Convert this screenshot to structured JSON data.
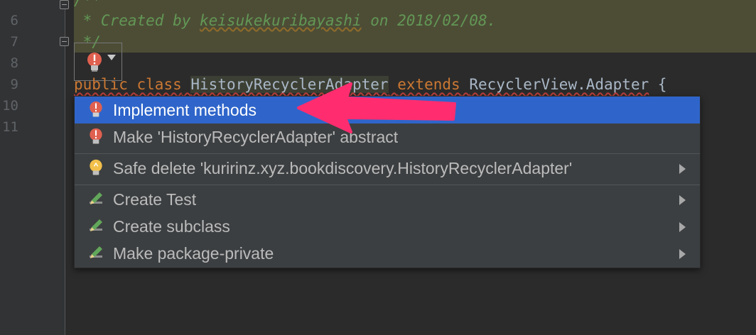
{
  "editor": {
    "line_numbers": [
      "6",
      "7",
      "8",
      "9",
      "10",
      "11"
    ],
    "comment_line_6_prefix": " * Created by ",
    "comment_line_6_author": "keisukekuribayashi",
    "comment_line_6_suffix": " on 2018/02/08.",
    "comment_line_7": " */",
    "comment_line_5_partial": "/**",
    "code_line_9": {
      "kw_public": "public",
      "kw_class": "class",
      "class_name": "HistoryRecyclerAdapter",
      "kw_extends": "extends",
      "super_class": "RecyclerView.Adapter",
      "brace": "{"
    }
  },
  "intention_bulb": {
    "icon": "red-bulb-icon",
    "dropdown_icon": "chevron-down-icon"
  },
  "popup": {
    "items": [
      {
        "label": "Implement methods",
        "icon": "red-bulb-icon",
        "selected": true,
        "submenu": false
      },
      {
        "label": "Make 'HistoryRecyclerAdapter' abstract",
        "icon": "red-bulb-icon",
        "selected": false,
        "submenu": false
      },
      {
        "label": "Safe delete 'kuririnz.xyz.bookdiscovery.HistoryRecyclerAdapter'",
        "icon": "yellow-bulb-icon",
        "selected": false,
        "submenu": true
      },
      {
        "label": "Create Test",
        "icon": "pencil-icon",
        "selected": false,
        "submenu": true
      },
      {
        "label": "Create subclass",
        "icon": "pencil-icon",
        "selected": false,
        "submenu": true
      },
      {
        "label": "Make package-private",
        "icon": "pencil-icon",
        "selected": false,
        "submenu": true
      }
    ]
  },
  "colors": {
    "background": "#2b2b2b",
    "selection": "#2f65ca",
    "keyword": "#cc7832",
    "doc_comment": "#629755",
    "annotation_arrow": "#ff2d6f"
  }
}
